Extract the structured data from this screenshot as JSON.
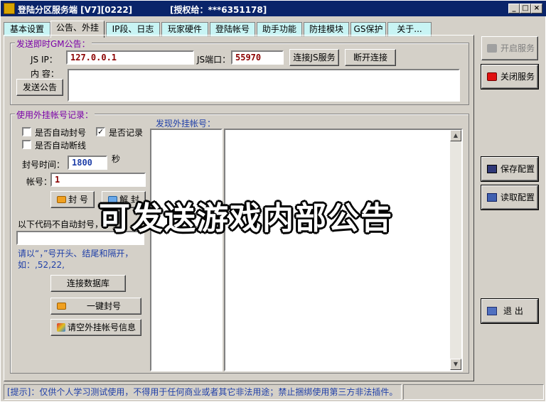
{
  "window": {
    "title": "登陆分区服务端 [V7][0222]",
    "license": "[授权给：***6351178]",
    "minimize": "_",
    "maximize": "□",
    "close": "×"
  },
  "tabs": [
    "基本设置",
    "公告、外挂",
    "IP段、日志",
    "玩家硬件",
    "登陆帐号",
    "助手功能",
    "防挂模块",
    "GS保护",
    "关于..."
  ],
  "gm_notice": {
    "legend": "发送即时GM公告：",
    "js_ip_label": "JS  IP：",
    "js_ip_value": "127.0.0.1",
    "js_port_label": "JS端口：",
    "js_port_value": "55970",
    "connect_button": "连接JS服务",
    "disconnect_button": "断开连接",
    "content_label": "内  容：",
    "send_button": "发送公告",
    "content_value": ""
  },
  "cheat": {
    "legend": "使用外挂帐号记录：",
    "auto_ban_label": "是否自动封号",
    "auto_ban_checked": false,
    "record_label": "是否记录",
    "record_checked": true,
    "auto_disconnect_label": "是否自动断线",
    "auto_disconnect_checked": false,
    "ban_time_label": "封号时间：",
    "ban_time_value": "1800",
    "ban_time_unit": "秒",
    "account_label": "帐号：",
    "account_value": "1",
    "ban_button": "封 号",
    "unban_button": "解 封",
    "no_auto_ban_label": "以下代码不自动封号，",
    "codes_value": "",
    "hint": "请以“，”号开头、结尾和隔开，如：,52,22,",
    "connect_db_button": "连接数据库",
    "one_click_ban_button": "一键封号",
    "clear_info_button": "请空外挂帐号信息",
    "found_label": "发现外挂帐号："
  },
  "side": {
    "start_service": "开启服务",
    "stop_service": "关闭服务",
    "save_config": "保存配置",
    "load_config": "读取配置",
    "exit": "退  出"
  },
  "overlay_caption": "可发送游戏内部公告",
  "status": {
    "text": "[提示]：仅供个人学习测试使用，不得用于任何商业或者其它非法用途；禁止捆绑使用第三方非法插件。",
    "right": ""
  },
  "colors": {
    "title_bg": "#0a246a",
    "tab_bg": "#c8f4f4",
    "legend_color": "#7a00a8",
    "value_color": "#8b0000",
    "hint_color": "#1f3fa8"
  }
}
